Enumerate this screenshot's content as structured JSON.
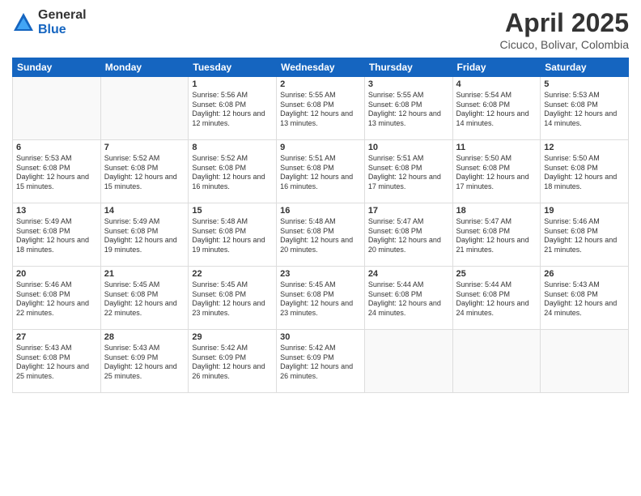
{
  "logo": {
    "general": "General",
    "blue": "Blue"
  },
  "title": "April 2025",
  "subtitle": "Cicuco, Bolivar, Colombia",
  "weekdays": [
    "Sunday",
    "Monday",
    "Tuesday",
    "Wednesday",
    "Thursday",
    "Friday",
    "Saturday"
  ],
  "days": [
    {
      "num": "",
      "info": ""
    },
    {
      "num": "",
      "info": ""
    },
    {
      "num": "1",
      "info": "Sunrise: 5:56 AM\nSunset: 6:08 PM\nDaylight: 12 hours\nand 12 minutes."
    },
    {
      "num": "2",
      "info": "Sunrise: 5:55 AM\nSunset: 6:08 PM\nDaylight: 12 hours\nand 13 minutes."
    },
    {
      "num": "3",
      "info": "Sunrise: 5:55 AM\nSunset: 6:08 PM\nDaylight: 12 hours\nand 13 minutes."
    },
    {
      "num": "4",
      "info": "Sunrise: 5:54 AM\nSunset: 6:08 PM\nDaylight: 12 hours\nand 14 minutes."
    },
    {
      "num": "5",
      "info": "Sunrise: 5:53 AM\nSunset: 6:08 PM\nDaylight: 12 hours\nand 14 minutes."
    },
    {
      "num": "6",
      "info": "Sunrise: 5:53 AM\nSunset: 6:08 PM\nDaylight: 12 hours\nand 15 minutes."
    },
    {
      "num": "7",
      "info": "Sunrise: 5:52 AM\nSunset: 6:08 PM\nDaylight: 12 hours\nand 15 minutes."
    },
    {
      "num": "8",
      "info": "Sunrise: 5:52 AM\nSunset: 6:08 PM\nDaylight: 12 hours\nand 16 minutes."
    },
    {
      "num": "9",
      "info": "Sunrise: 5:51 AM\nSunset: 6:08 PM\nDaylight: 12 hours\nand 16 minutes."
    },
    {
      "num": "10",
      "info": "Sunrise: 5:51 AM\nSunset: 6:08 PM\nDaylight: 12 hours\nand 17 minutes."
    },
    {
      "num": "11",
      "info": "Sunrise: 5:50 AM\nSunset: 6:08 PM\nDaylight: 12 hours\nand 17 minutes."
    },
    {
      "num": "12",
      "info": "Sunrise: 5:50 AM\nSunset: 6:08 PM\nDaylight: 12 hours\nand 18 minutes."
    },
    {
      "num": "13",
      "info": "Sunrise: 5:49 AM\nSunset: 6:08 PM\nDaylight: 12 hours\nand 18 minutes."
    },
    {
      "num": "14",
      "info": "Sunrise: 5:49 AM\nSunset: 6:08 PM\nDaylight: 12 hours\nand 19 minutes."
    },
    {
      "num": "15",
      "info": "Sunrise: 5:48 AM\nSunset: 6:08 PM\nDaylight: 12 hours\nand 19 minutes."
    },
    {
      "num": "16",
      "info": "Sunrise: 5:48 AM\nSunset: 6:08 PM\nDaylight: 12 hours\nand 20 minutes."
    },
    {
      "num": "17",
      "info": "Sunrise: 5:47 AM\nSunset: 6:08 PM\nDaylight: 12 hours\nand 20 minutes."
    },
    {
      "num": "18",
      "info": "Sunrise: 5:47 AM\nSunset: 6:08 PM\nDaylight: 12 hours\nand 21 minutes."
    },
    {
      "num": "19",
      "info": "Sunrise: 5:46 AM\nSunset: 6:08 PM\nDaylight: 12 hours\nand 21 minutes."
    },
    {
      "num": "20",
      "info": "Sunrise: 5:46 AM\nSunset: 6:08 PM\nDaylight: 12 hours\nand 22 minutes."
    },
    {
      "num": "21",
      "info": "Sunrise: 5:45 AM\nSunset: 6:08 PM\nDaylight: 12 hours\nand 22 minutes."
    },
    {
      "num": "22",
      "info": "Sunrise: 5:45 AM\nSunset: 6:08 PM\nDaylight: 12 hours\nand 23 minutes."
    },
    {
      "num": "23",
      "info": "Sunrise: 5:45 AM\nSunset: 6:08 PM\nDaylight: 12 hours\nand 23 minutes."
    },
    {
      "num": "24",
      "info": "Sunrise: 5:44 AM\nSunset: 6:08 PM\nDaylight: 12 hours\nand 24 minutes."
    },
    {
      "num": "25",
      "info": "Sunrise: 5:44 AM\nSunset: 6:08 PM\nDaylight: 12 hours\nand 24 minutes."
    },
    {
      "num": "26",
      "info": "Sunrise: 5:43 AM\nSunset: 6:08 PM\nDaylight: 12 hours\nand 24 minutes."
    },
    {
      "num": "27",
      "info": "Sunrise: 5:43 AM\nSunset: 6:08 PM\nDaylight: 12 hours\nand 25 minutes."
    },
    {
      "num": "28",
      "info": "Sunrise: 5:43 AM\nSunset: 6:09 PM\nDaylight: 12 hours\nand 25 minutes."
    },
    {
      "num": "29",
      "info": "Sunrise: 5:42 AM\nSunset: 6:09 PM\nDaylight: 12 hours\nand 26 minutes."
    },
    {
      "num": "30",
      "info": "Sunrise: 5:42 AM\nSunset: 6:09 PM\nDaylight: 12 hours\nand 26 minutes."
    },
    {
      "num": "",
      "info": ""
    },
    {
      "num": "",
      "info": ""
    },
    {
      "num": "",
      "info": ""
    }
  ]
}
